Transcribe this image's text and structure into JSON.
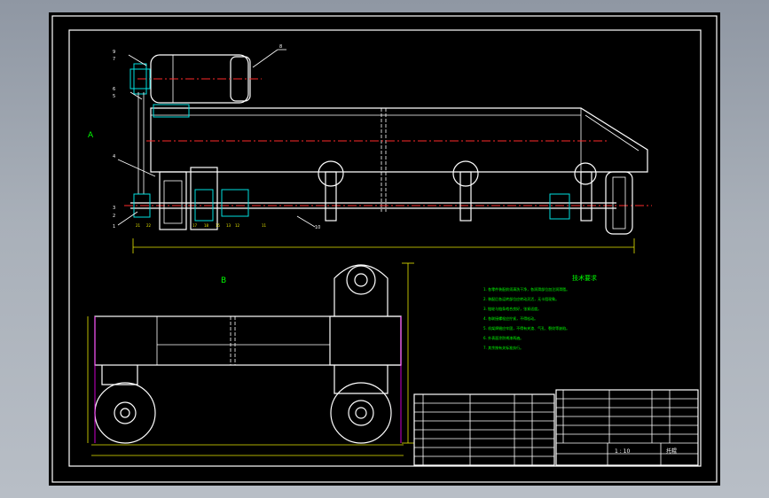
{
  "drawing": {
    "top_view_label": "A",
    "bottom_view_label": "B",
    "tech_requirements": {
      "title": "技术要求",
      "items": [
        "1. 各零件装配前须清洗干净，各润滑部位加注润滑脂。",
        "2. 装配后各运转部位应转动灵活，无卡阻现象。",
        "3. 链轮与链条啮合良好，张紧适度。",
        "4. 各联接螺栓应拧紧，不得松动。",
        "5. 机架焊缝应牢固，不得有夹渣、气孔、裂纹等缺陷。",
        "6. 外表面涂防锈漆两遍。",
        "7. 其余按有关标准执行。"
      ]
    },
    "part_labels": [
      "1",
      "2",
      "3",
      "4",
      "5",
      "6",
      "7",
      "8",
      "9",
      "10",
      "11",
      "12",
      "13",
      "14",
      "15",
      "16",
      "17",
      "18",
      "19",
      "20",
      "21",
      "22"
    ],
    "title_block": {
      "scale": "1 : 10",
      "name": "托辊"
    }
  }
}
